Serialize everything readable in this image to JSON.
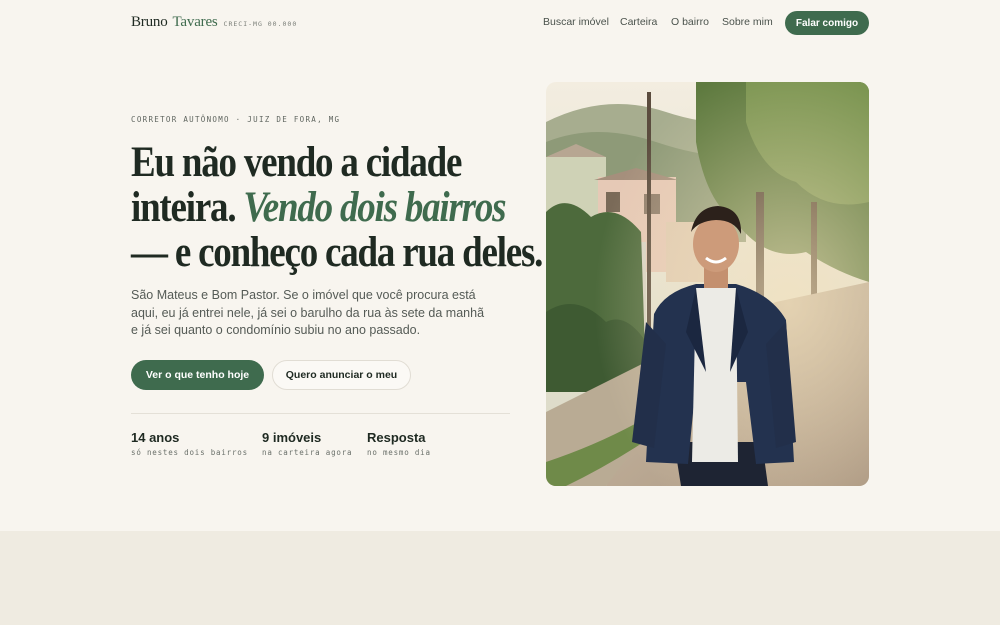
{
  "brand": {
    "first_name": "Bruno",
    "last_name": "Tavares",
    "creci": "CRECI-MG 00.000"
  },
  "nav": {
    "items": [
      {
        "label": "Buscar imóvel"
      },
      {
        "label": "Carteira"
      },
      {
        "label": "O bairro"
      },
      {
        "label": "Sobre mim"
      }
    ],
    "cta": "Falar comigo"
  },
  "hero": {
    "eyebrow": "CORRETOR AUTÔNOMO · JUIZ DE FORA, MG",
    "headline": {
      "line1": "Eu não vendo a cidade",
      "line2_plain": "inteira.",
      "line2_accent": "Vendo dois bairros",
      "line3": "— e conheço cada rua deles."
    },
    "lede": "São Mateus e Bom Pastor. Se o imóvel que você procura está aqui, eu já entrei nele, já sei o barulho da rua às sete da manhã e já sei quanto o condomínio subiu no ano passado.",
    "primary_button": "Ver o que tenho hoje",
    "secondary_button": "Quero anunciar o meu"
  },
  "stats": [
    {
      "value": "14 anos",
      "caption": "só nestes dois bairros"
    },
    {
      "value": "9 imóveis",
      "caption": "na carteira agora"
    },
    {
      "value": "Resposta",
      "caption": "no mesmo dia"
    }
  ],
  "colors": {
    "accent": "#3f6b4e",
    "background": "#f8f5ef",
    "band": "#efebe1",
    "text": "#1f2a22"
  }
}
